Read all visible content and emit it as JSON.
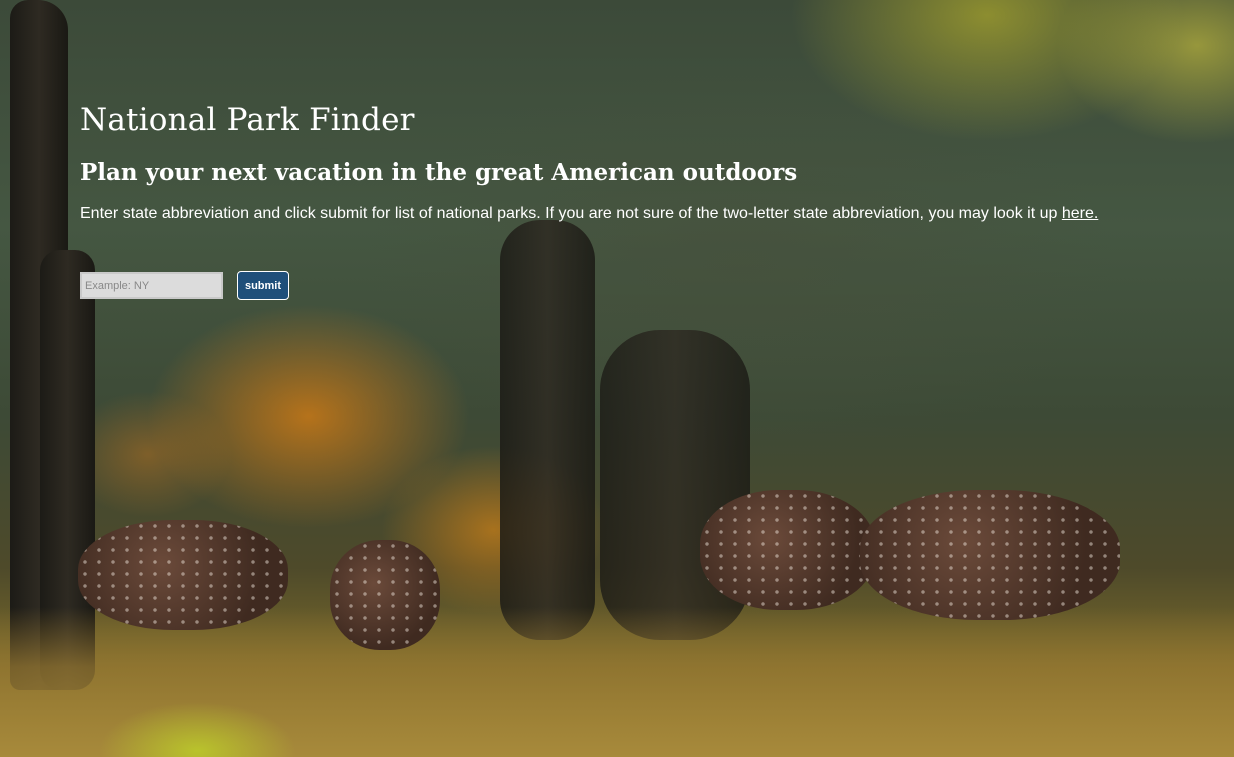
{
  "header": {
    "title": "National Park Finder",
    "subtitle": "Plan your next vacation in the great American outdoors"
  },
  "instructions": {
    "text": "Enter state abbreviation and click submit for list of national parks. If you are not sure of the two-letter state abbreviation, you may look it up ",
    "link_label": "here."
  },
  "search": {
    "placeholder": "Example: NY",
    "value": "",
    "submit_label": "submit"
  },
  "colors": {
    "submit_button": "#1f4f7a",
    "text": "#ffffff"
  }
}
